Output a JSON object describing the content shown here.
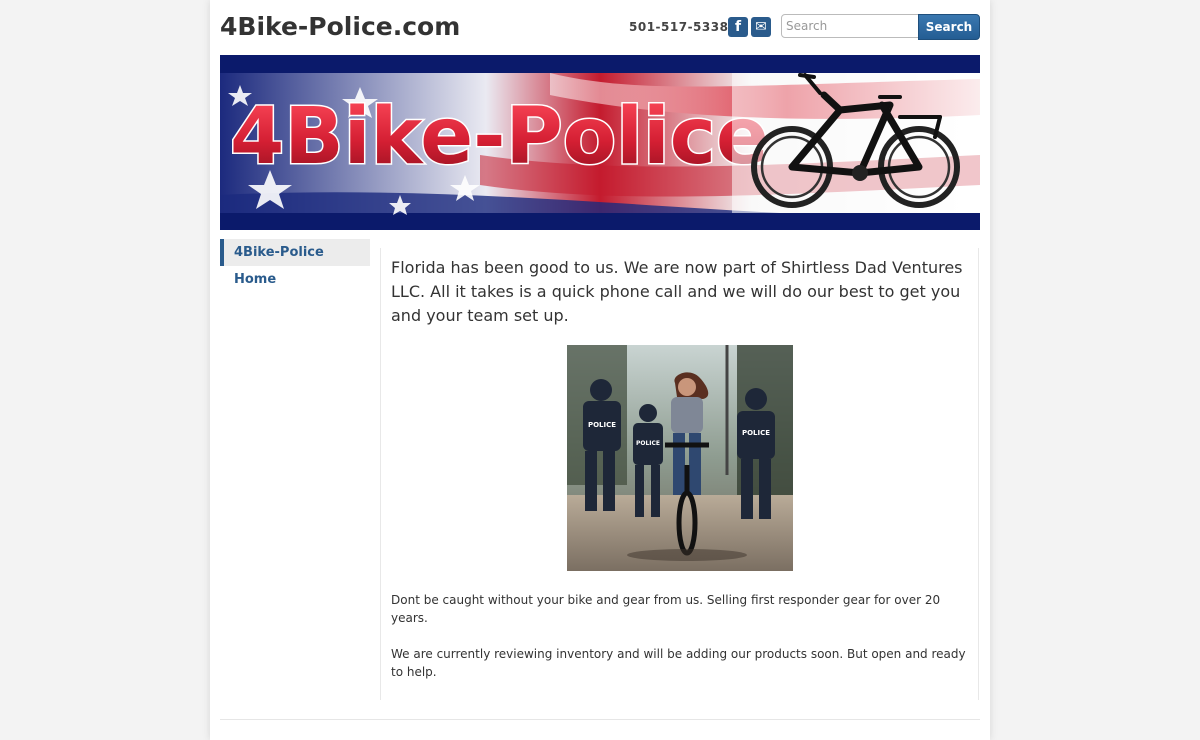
{
  "header": {
    "site_title": "4Bike-Police.com",
    "phone": "501-517-5338",
    "facebook_glyph": "f",
    "mail_glyph": "✉",
    "search_placeholder": "Search",
    "search_button_label": "Search"
  },
  "banner": {
    "logo_text": "4Bike-Police",
    "image": "american-flag-with-bicycle"
  },
  "nav": {
    "items": [
      {
        "label": "4Bike-Police Home"
      }
    ]
  },
  "main": {
    "lead": "Florida has been good to us. We are now part of Shirtless Dad Ventures LLC. All it takes is a quick phone call and we will do our best to get you and your team set up.",
    "photo": {
      "subject": "woman-riding-bicycle-chased-by-police-officers",
      "vest_label": "POLICE"
    },
    "paragraph_1": "Dont be caught without your bike and gear from us. Selling first responder gear for over 20 years.",
    "paragraph_2": "We are currently reviewing inventory and will be adding our products soon. But open and ready to help."
  },
  "colors": {
    "accent": "#2a5b8c",
    "banner_navy": "#0b1a6b",
    "logo_red": "#d41f33",
    "page_bg": "#f3f3f3"
  }
}
